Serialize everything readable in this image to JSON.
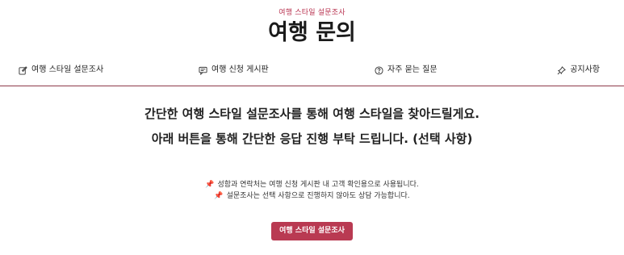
{
  "header": {
    "eyebrow": "여행 스타일 설문조사",
    "title": "여행 문의"
  },
  "nav": {
    "items": [
      {
        "label": "여행 스타일 설문조사",
        "icon": "edit-icon"
      },
      {
        "label": "여행 신청 게시판",
        "icon": "message-icon"
      },
      {
        "label": "자주 묻는 질문",
        "icon": "help-circle-icon"
      },
      {
        "label": "공지사항",
        "icon": "pin-icon"
      }
    ]
  },
  "intro": {
    "line1": "간단한 여행 스타일 설문조사를 통해 여행 스타일을 찾아드릴게요.",
    "line2": "아래 버튼을 통해 간단한 응답 진행 부탁 드립니다. (선택 사항)"
  },
  "notes": [
    {
      "icon": "pushpin-icon",
      "text": "성함과 연락처는 여행 신청 게시판 내 고객 확인용으로 사용됩니다."
    },
    {
      "icon": "pushpin-icon",
      "text": "설문조사는 선택 사항으로 진행하지 않아도 상담 가능합니다."
    }
  ],
  "cta": {
    "label": "여행 스타일 설문조사"
  },
  "colors": {
    "accent": "#b93a52",
    "divider": "#8e3a4a",
    "pin": "#d7263d"
  }
}
